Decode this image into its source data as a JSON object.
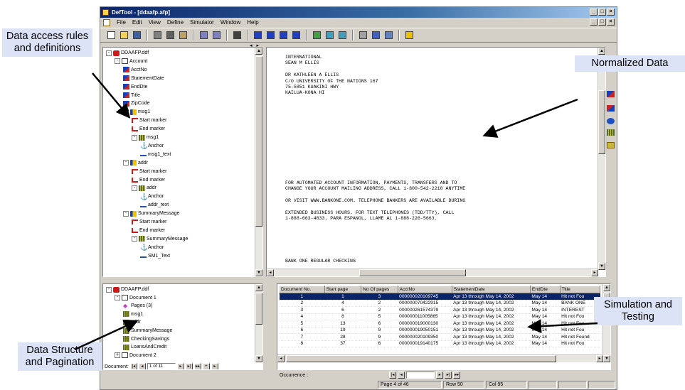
{
  "window": {
    "title": "DefTool - [ddaafp.afp]",
    "controls": [
      "_",
      "□",
      "×"
    ]
  },
  "menu": [
    {
      "label": "File",
      "key": "F"
    },
    {
      "label": "Edit",
      "key": "E"
    },
    {
      "label": "View",
      "key": "V"
    },
    {
      "label": "Define",
      "key": "D"
    },
    {
      "label": "Simulator",
      "key": "S"
    },
    {
      "label": "Window",
      "key": "W"
    },
    {
      "label": "Help",
      "key": "H"
    }
  ],
  "toolbar_icons": [
    "new-icon",
    "open-icon",
    "save-icon",
    "cut-icon",
    "copy-icon",
    "paste-icon",
    "undo-icon",
    "redo-icon",
    "print-icon",
    "first-icon",
    "previous-icon",
    "next-icon",
    "last-icon",
    "grid-icon",
    "simulate-icon",
    "simulate-all-icon",
    "form-icon",
    "table-icon",
    "properties-icon",
    "help-icon"
  ],
  "definition_tree": {
    "root": "DDAAFP.ddf",
    "items": [
      {
        "label": "Account",
        "icon": "doc-icon",
        "level": 1,
        "exp": "-"
      },
      {
        "label": "AcctNo",
        "icon": "field-icon",
        "level": 2
      },
      {
        "label": "StatementDate",
        "icon": "field-icon",
        "level": 2
      },
      {
        "label": "EndDte",
        "icon": "field-icon",
        "level": 2
      },
      {
        "label": "Title",
        "icon": "field-icon",
        "level": 2
      },
      {
        "label": "ZipCode",
        "icon": "field-icon",
        "level": 2
      },
      {
        "label": "msg1",
        "icon": "block-icon",
        "level": 2,
        "exp": "-"
      },
      {
        "label": "Start marker",
        "icon": "start-marker-icon",
        "level": 3
      },
      {
        "label": "End marker",
        "icon": "end-marker-icon",
        "level": 3
      },
      {
        "label": "msg1",
        "icon": "table-icon",
        "level": 3,
        "exp": "-"
      },
      {
        "label": "Anchor",
        "icon": "anchor-icon",
        "level": 4
      },
      {
        "label": "msg1_text",
        "icon": "text-icon",
        "level": 4
      },
      {
        "label": "addr",
        "icon": "block-icon",
        "level": 2,
        "exp": "-"
      },
      {
        "label": "Start marker",
        "icon": "start-marker-icon",
        "level": 3
      },
      {
        "label": "End marker",
        "icon": "end-marker-icon",
        "level": 3
      },
      {
        "label": "addr",
        "icon": "table-icon",
        "level": 3,
        "exp": "-"
      },
      {
        "label": "Anchor",
        "icon": "anchor-icon",
        "level": 4
      },
      {
        "label": "addr_text",
        "icon": "text-icon",
        "level": 4
      },
      {
        "label": "SummaryMessage",
        "icon": "block-icon",
        "level": 2,
        "exp": "-"
      },
      {
        "label": "Start marker",
        "icon": "start-marker-icon",
        "level": 3
      },
      {
        "label": "End marker",
        "icon": "end-marker-icon",
        "level": 3
      },
      {
        "label": "SummaryMessage",
        "icon": "table-icon",
        "level": 3,
        "exp": "-"
      },
      {
        "label": "Anchor",
        "icon": "anchor-icon",
        "level": 4
      },
      {
        "label": "SM1_Text",
        "icon": "text-icon",
        "level": 4
      }
    ]
  },
  "document_text": {
    "block1": "INTERNATIONAL\nSEAN M ELLIS\n\nDR KATHLEEN A ELLIS\nC/O UNIVERSITY OF THE NATIONS 167\n75-5851 KUAKINI HWY\nKAILUA-KONA HI",
    "block2": "FOR AUTOMATED ACCOUNT INFORMATION, PAYMENTS, TRANSFERS AND TO\nCHANGE YOUR ACCOUNT MAILING ADDRESS, CALL 1-800-542-2218 ANYTIME\n\nOR VISIT WWW.BANKONE.COM. TELEPHONE BANKERS ARE AVAILABLE DURING\n\nEXTENDED BUSINESS HOURS. FOR TEXT TELEPHONES (TDD/TTY), CALL\n1-888-663-4833. PARA ESPANOL, LLAME AL 1-888-226-5663.",
    "block3": "BANK ONE REGULAR CHECKING"
  },
  "structure_tree": {
    "root": "DDAAFP.ddf",
    "items": [
      {
        "label": "Document 1",
        "icon": "doc-icon",
        "level": 1,
        "exp": "-"
      },
      {
        "label": "Pages (3)",
        "icon": "pages-icon",
        "level": 2
      },
      {
        "label": "msg1",
        "icon": "table-icon",
        "level": 2
      },
      {
        "label": "addr",
        "icon": "table-icon",
        "level": 2
      },
      {
        "label": "SummaryMessage",
        "icon": "table-icon",
        "level": 2
      },
      {
        "label": "CheckingSavings",
        "icon": "table-icon",
        "level": 2
      },
      {
        "label": "LoansAndCredit",
        "icon": "table-icon",
        "level": 2
      },
      {
        "label": "Document 2",
        "icon": "doc-icon",
        "level": 1,
        "exp": "+"
      }
    ],
    "nav_label": "Document:",
    "nav_value": "1 of 11"
  },
  "results_table": {
    "columns": [
      "Document No.",
      "Start page",
      "No Of pages",
      "AcctNo",
      "StatementDate",
      "EndDte",
      "Title"
    ],
    "rows": [
      [
        "1",
        "1",
        "3",
        "000000020109745",
        "Apr 13 through May 14, 2002",
        "May 14",
        "Hit not Fou"
      ],
      [
        "2",
        "4",
        "2",
        "000000070422915",
        "Apr 13 through May 14, 2002",
        "May 14",
        "BANK ONE"
      ],
      [
        "3",
        "6",
        "2",
        "000000261574379",
        "Apr 13 through May 14, 2002",
        "May 14",
        "INTEREST"
      ],
      [
        "4",
        "8",
        "5",
        "000000011005865",
        "Apr 13 through May 14, 2002",
        "May 14",
        "Hit not Fou"
      ],
      [
        "5",
        "13",
        "6",
        "000000019000130",
        "Apr 13 through May 14, 2002",
        "May 14",
        "Hit not Fou"
      ],
      [
        "6",
        "19",
        "9",
        "000000019050151",
        "Apr 13 through May 14, 2002",
        "May 14",
        "Hit not Fou"
      ],
      [
        "7",
        "28",
        "9",
        "000000020109350",
        "Apr 13 through May 14, 2002",
        "May 14",
        "Hit not Found"
      ],
      [
        "8",
        "37",
        "6",
        "000000019140175",
        "Apr 13 through May 14, 2002",
        "May 14",
        "Hit not Fou"
      ]
    ],
    "occurrence_label": "Occurrence :"
  },
  "status": {
    "page": "Page  4 of 46",
    "row": "Row  50",
    "col": "Col  95"
  },
  "callouts": {
    "data_access": "Data access rules and definitions",
    "normalized": "Normalized Data",
    "simulation": "Simulation and Testing",
    "structure": "Data Structure and Pagination"
  },
  "colors": {
    "title_bar": "#0a246a",
    "callout_bg": "#dde3f7",
    "selection": "#0a246a",
    "panel": "#d4d0c8"
  }
}
